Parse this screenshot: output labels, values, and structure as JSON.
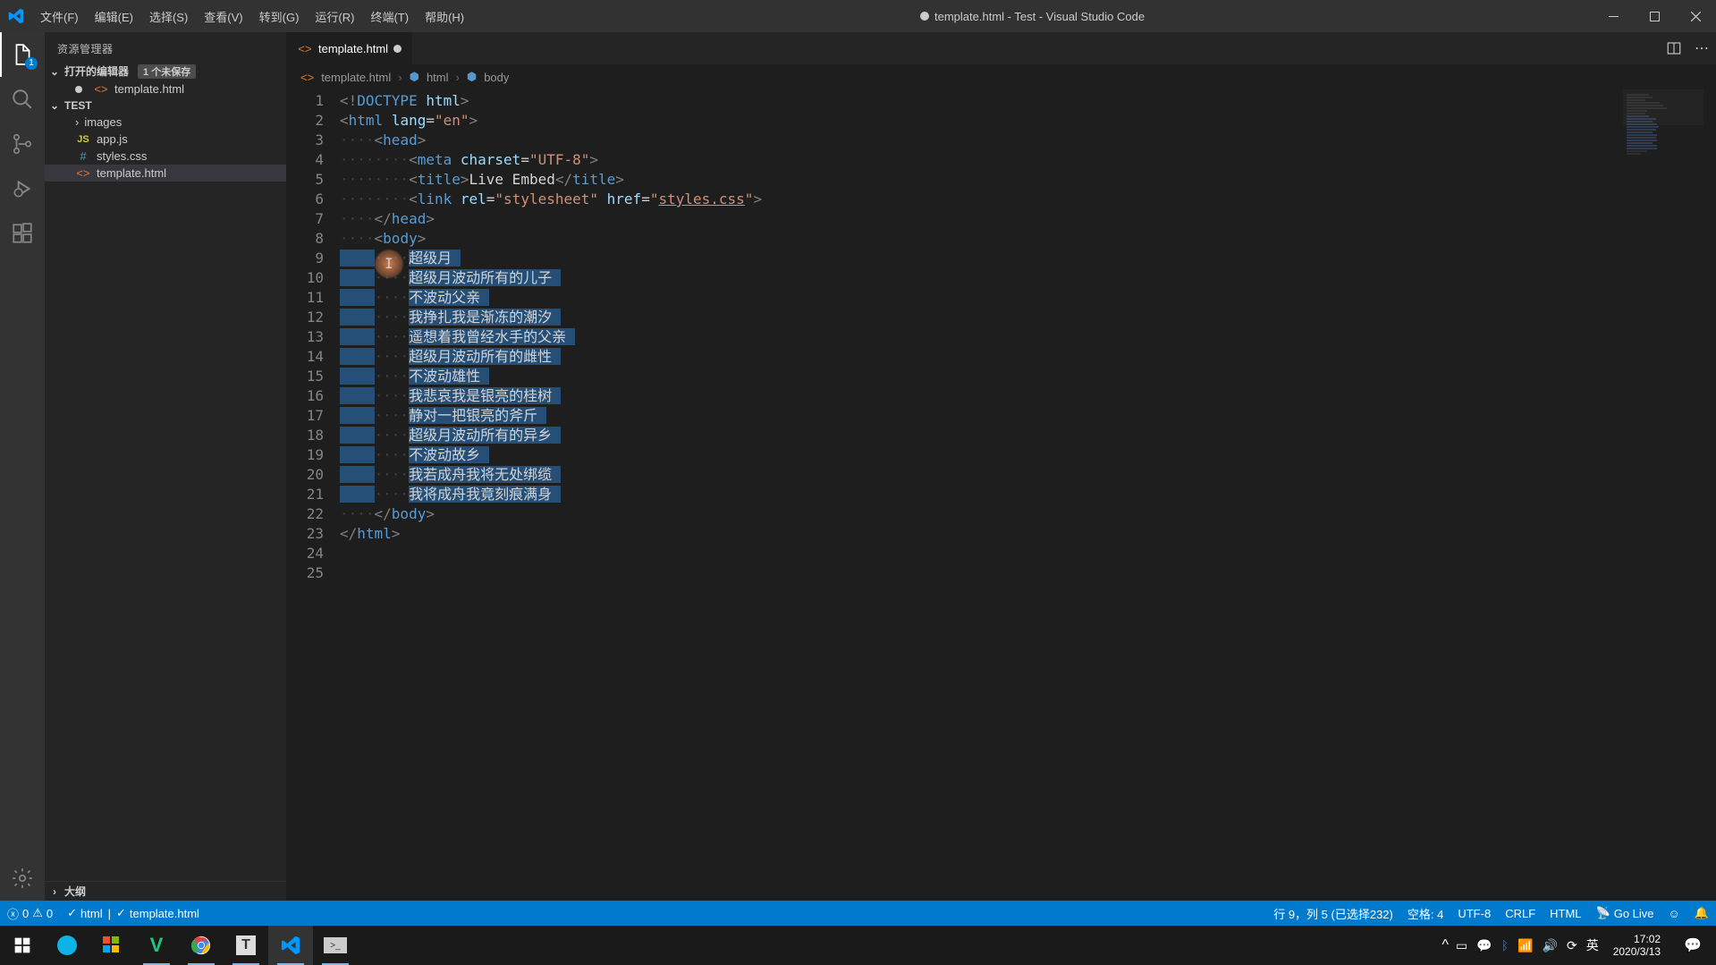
{
  "titlebar": {
    "menu": [
      "文件(F)",
      "编辑(E)",
      "选择(S)",
      "查看(V)",
      "转到(G)",
      "运行(R)",
      "终端(T)",
      "帮助(H)"
    ],
    "title": "template.html - Test - Visual Studio Code"
  },
  "activitybar": {
    "explorer_badge": "1"
  },
  "sidebar": {
    "title": "资源管理器",
    "open_editors": {
      "label": "打开的编辑器",
      "unsaved": "1 个未保存"
    },
    "open_file": "template.html",
    "workspace": "TEST",
    "files": [
      {
        "name": "images",
        "type": "folder"
      },
      {
        "name": "app.js",
        "type": "js"
      },
      {
        "name": "styles.css",
        "type": "css"
      },
      {
        "name": "template.html",
        "type": "html",
        "selected": true
      }
    ],
    "outline": "大纲"
  },
  "tab": {
    "name": "template.html"
  },
  "breadcrumb": {
    "file": "template.html",
    "el1": "html",
    "el2": "body"
  },
  "editor": {
    "line_count": 25,
    "poem": [
      "超级月",
      "超级月波动所有的儿子",
      "不波动父亲",
      "我挣扎我是渐冻的潮汐",
      "遥想着我曾经水手的父亲",
      "超级月波动所有的雌性",
      "不波动雄性",
      "我悲哀我是银亮的桂树",
      "静对一把银亮的斧斤",
      "超级月波动所有的异乡",
      "不波动故乡",
      "我若成舟我将无处绑缆",
      "我将成舟我竟刻痕满身"
    ]
  },
  "statusbar": {
    "errors": "0",
    "warnings": "0",
    "check1": "html",
    "check2": "template.html",
    "cursor": "行 9，列 5 (已选择232)",
    "spaces": "空格: 4",
    "encoding": "UTF-8",
    "eol": "CRLF",
    "lang": "HTML",
    "golive": "Go Live"
  },
  "taskbar": {
    "time": "17:02",
    "date": "2020/3/13",
    "ime": "英"
  }
}
